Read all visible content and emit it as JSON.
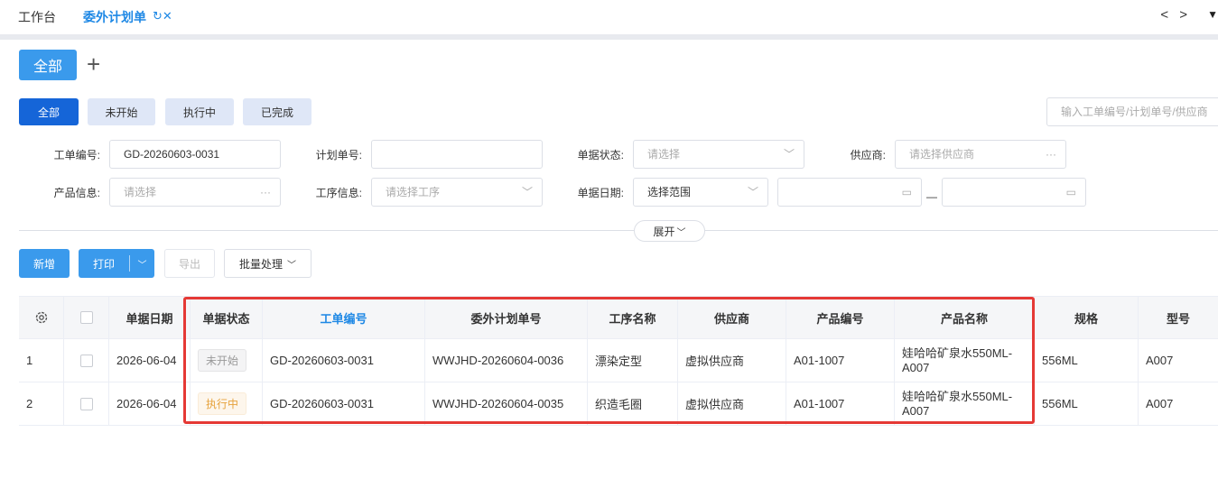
{
  "tabs": {
    "workbench": "工作台",
    "active": "委外计划单",
    "nav_arrows": "< >"
  },
  "quick_filter": {
    "all": "全部"
  },
  "status_tabs": [
    "全部",
    "未开始",
    "执行中",
    "已完成"
  ],
  "search": {
    "placeholder": "输入工单编号/计划单号/供应商"
  },
  "filters": {
    "work_order_no": {
      "label": "工单编号:",
      "value": "GD-20260603-0031"
    },
    "plan_no": {
      "label": "计划单号:",
      "value": ""
    },
    "doc_status": {
      "label": "单据状态:",
      "placeholder": "请选择"
    },
    "supplier": {
      "label": "供应商:",
      "placeholder": "请选择供应商"
    },
    "product_info": {
      "label": "产品信息:",
      "placeholder": "请选择"
    },
    "process_info": {
      "label": "工序信息:",
      "placeholder": "请选择工序"
    },
    "doc_date": {
      "label": "单据日期:",
      "value": "选择范围"
    }
  },
  "expand_label": "展开",
  "toolbar": {
    "add": "新增",
    "print": "打印",
    "export": "导出",
    "batch": "批量处理"
  },
  "table": {
    "columns": [
      "单据日期",
      "单据状态",
      "工单编号",
      "委外计划单号",
      "工序名称",
      "供应商",
      "产品编号",
      "产品名称",
      "规格",
      "型号"
    ],
    "rows": [
      {
        "index": "1",
        "date": "2026-06-04",
        "status": "未开始",
        "work_order": "GD-20260603-0031",
        "plan_no": "WWJHD-20260604-0036",
        "process": "漂染定型",
        "supplier": "虚拟供应商",
        "product_no": "A01-1007",
        "product_name": "娃哈哈矿泉水550ML-A007",
        "spec": "556ML",
        "model": "A007"
      },
      {
        "index": "2",
        "date": "2026-06-04",
        "status": "执行中",
        "work_order": "GD-20260603-0031",
        "plan_no": "WWJHD-20260604-0035",
        "process": "织造毛圈",
        "supplier": "虚拟供应商",
        "product_no": "A01-1007",
        "product_name": "娃哈哈矿泉水550ML-A007",
        "spec": "556ML",
        "model": "A007"
      }
    ]
  },
  "colors": {
    "accent": "#1e88e5",
    "primary_button": "#3a9aec",
    "highlight_border": "#e53935"
  }
}
